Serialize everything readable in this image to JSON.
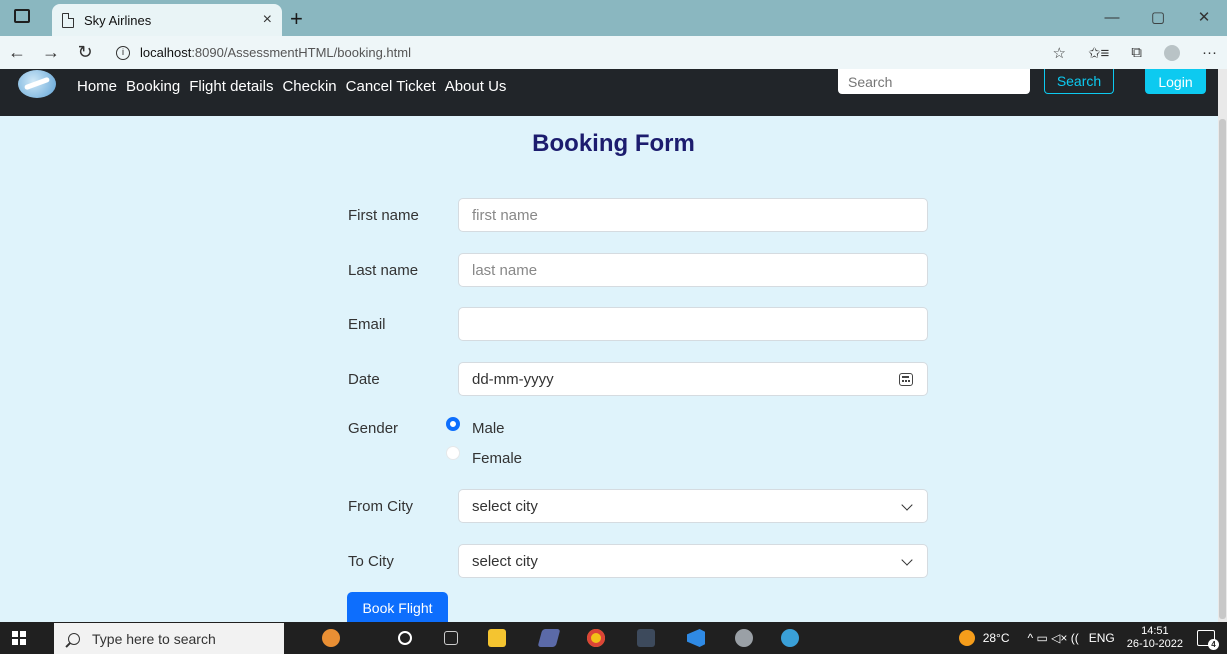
{
  "browser": {
    "tab_title": "Sky Airlines",
    "tab_close": "×",
    "new_tab": "+",
    "url_host": "localhost",
    "url_path": ":8090/AssessmentHTML/booking.html",
    "win_minimize": "—",
    "win_restore": "▢",
    "win_close": "✕",
    "back": "←",
    "forward": "→",
    "refresh": "↻",
    "more": "···"
  },
  "navbar": {
    "links": [
      "Home",
      "Booking",
      "Flight details",
      "Checkin",
      "Cancel Ticket",
      "About Us"
    ],
    "search_placeholder": "Search",
    "search_button": "Search",
    "login_button": "Login"
  },
  "form": {
    "title": "Booking Form",
    "first_name": {
      "label": "First name",
      "placeholder": "first name"
    },
    "last_name": {
      "label": "Last name",
      "placeholder": "last name"
    },
    "email": {
      "label": "Email",
      "value": ""
    },
    "date": {
      "label": "Date",
      "value": "dd-mm-yyyy"
    },
    "gender": {
      "label": "Gender",
      "options": [
        "Male",
        "Female"
      ],
      "selected": "Male"
    },
    "from_city": {
      "label": "From City",
      "value": "select city"
    },
    "to_city": {
      "label": "To City",
      "value": "select city"
    },
    "submit": "Book Flight"
  },
  "taskbar": {
    "search_text": "Type here to search",
    "weather": "28°C",
    "language": "ENG",
    "time": "14:51",
    "date": "26-10-2022",
    "notifications": "4",
    "tray_icons": "^  ▭  ◁×  ((",
    "colors": {
      "chrome": "#f2c118",
      "files": "#f4c430",
      "vscode": "#2f8ae5",
      "edge": "#3aa0d8"
    }
  },
  "colors": {
    "page_bg": "#dff3fb",
    "navbar_bg": "#212529",
    "accent": "#0dcaf0",
    "primary": "#0d6efd",
    "title": "#1c1c6e"
  }
}
